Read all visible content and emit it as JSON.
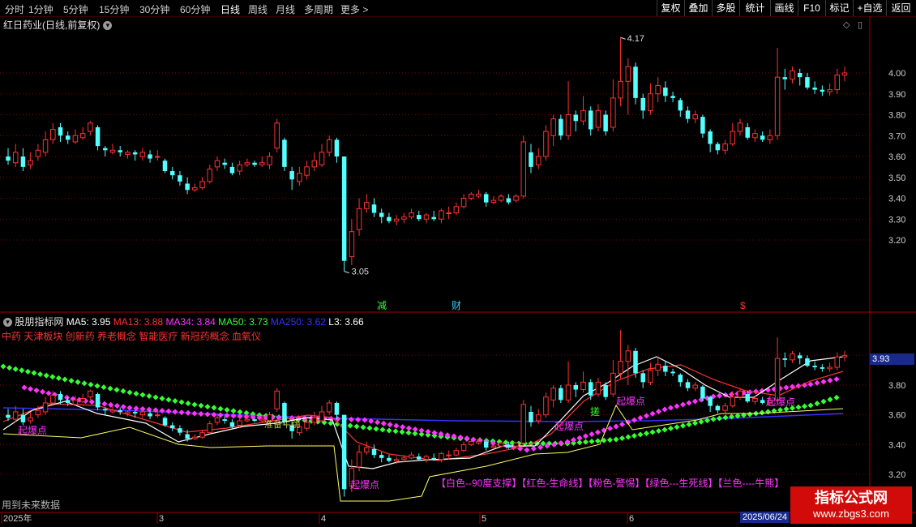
{
  "topbar": {
    "periods": [
      "分时",
      "1分钟",
      "5分钟",
      "15分钟",
      "30分钟",
      "60分钟",
      "日线",
      "周线",
      "月线",
      "多周期",
      "更多"
    ],
    "active_period": "日线",
    "right_buttons": [
      "复权",
      "叠加",
      "多股",
      "统计",
      "画线",
      "F10",
      "标记",
      "+自选",
      "返回"
    ]
  },
  "main_chart": {
    "title": "红日药业(日线,前复权)",
    "price_labels": [
      "4.00",
      "3.90",
      "3.80",
      "3.70",
      "3.60",
      "3.50",
      "3.40",
      "3.30",
      "3.20"
    ],
    "high_marker": "4.17",
    "low_marker": "3.05",
    "event_markers": [
      {
        "text": "减",
        "color": "#33ff33"
      },
      {
        "text": "财",
        "color": "#33ccff"
      },
      {
        "text": "$",
        "color": "#ff3333"
      }
    ]
  },
  "indicator": {
    "name": "股朋指标网",
    "ma_values": [
      {
        "label": "MA5: 3.95",
        "color": "#ffffff"
      },
      {
        "label": "MA13: 3.88",
        "color": "#ff3333"
      },
      {
        "label": "MA34: 3.84",
        "color": "#ff33ff"
      },
      {
        "label": "MA50: 3.73",
        "color": "#33ff33"
      },
      {
        "label": "MA250: 3.62",
        "color": "#3333ff"
      },
      {
        "label": "L3: 3.66",
        "color": "#ffffff"
      }
    ],
    "concepts": "中药 天津板块 创新药 养老概念 智能医疗 新冠药概念 血氧仪",
    "price_labels": [
      "3.80",
      "3.60",
      "3.40",
      "3.20"
    ],
    "current_value": "3.93",
    "annotations": [
      "起爆点",
      "起爆点",
      "起爆点",
      "起爆点",
      "起爆点",
      "搓",
      "准备牛跳"
    ],
    "legend": "【白色--90度支撑】【红色-生命线】【粉色-警惕】【绿色---生死线】【兰色----牛熊】"
  },
  "x_axis": {
    "labels": [
      "2025年",
      "3",
      "4",
      "5",
      "6"
    ],
    "cursor_date": "2025/06/24"
  },
  "bottom_note": "用到未来数据",
  "watermark": {
    "line1": "指标公式网",
    "line2": "www.zbgs3.com"
  },
  "colors": {
    "up": "#ff3232",
    "down": "#54ffff",
    "grid": "#8b0000",
    "background": "#000000"
  }
}
